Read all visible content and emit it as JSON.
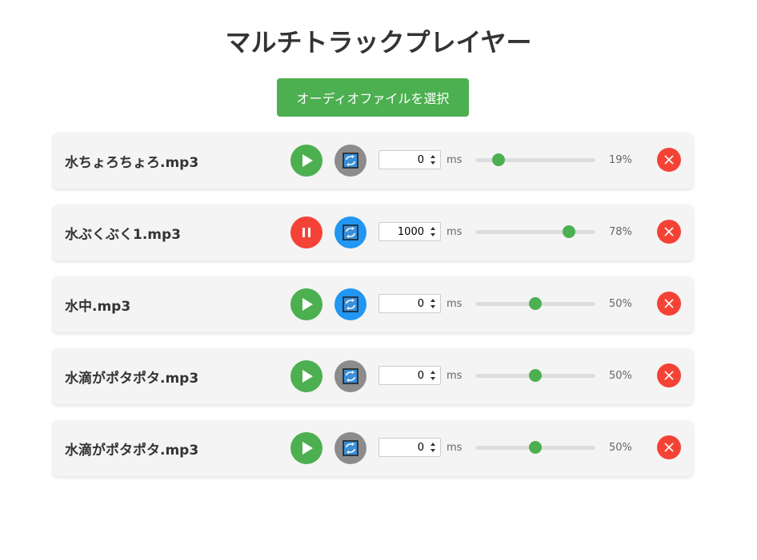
{
  "header": {
    "title": "マルチトラックプレイヤー",
    "select_button_label": "オーディオファイルを選択"
  },
  "colors": {
    "play": "#4caf50",
    "pause": "#f44336",
    "loop_on": "#2196f3",
    "loop_off": "#8c8c8c",
    "delete": "#f44336",
    "slider_thumb": "#4caf50"
  },
  "tracks": [
    {
      "name": "水ちょろちょろ.mp3",
      "state": "play-icon",
      "loop": false,
      "delay": "0",
      "unit": "ms",
      "volume": 19,
      "volume_label": "19%"
    },
    {
      "name": "水ぶくぶく1.mp3",
      "state": "pause-icon",
      "loop": true,
      "delay": "1000",
      "unit": "ms",
      "volume": 78,
      "volume_label": "78%"
    },
    {
      "name": "水中.mp3",
      "state": "play-icon",
      "loop": true,
      "delay": "0",
      "unit": "ms",
      "volume": 50,
      "volume_label": "50%"
    },
    {
      "name": "水滴がポタポタ.mp3",
      "state": "play-icon",
      "loop": false,
      "delay": "0",
      "unit": "ms",
      "volume": 50,
      "volume_label": "50%"
    },
    {
      "name": "水滴がポタポタ.mp3",
      "state": "play-icon",
      "loop": false,
      "delay": "0",
      "unit": "ms",
      "volume": 50,
      "volume_label": "50%"
    }
  ]
}
